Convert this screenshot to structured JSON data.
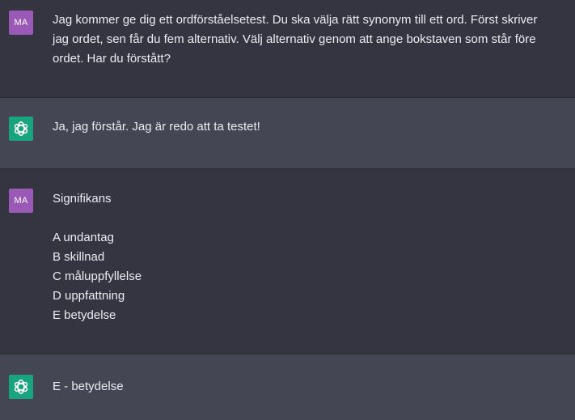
{
  "messages": [
    {
      "role": "user",
      "avatar_initials": "MA",
      "lines": [
        "Jag kommer ge dig ett ordförståelsetest. Du ska välja rätt synonym till ett ord. Först skriver",
        "jag ordet, sen får du fem alternativ. Välj alternativ genom att ange bokstaven som står före",
        "ordet. Har du förstått?"
      ]
    },
    {
      "role": "assistant",
      "avatar_icon": "openai-logo-icon",
      "lines": [
        "Ja, jag förstår. Jag är redo att ta testet!"
      ]
    },
    {
      "role": "user",
      "avatar_initials": "MA",
      "word": "Signifikans",
      "options": [
        "A undantag",
        "B skillnad",
        "C måluppfyllelse",
        "D uppfattning",
        "E betydelse"
      ]
    },
    {
      "role": "assistant",
      "avatar_icon": "openai-logo-icon",
      "lines": [
        "E - betydelse"
      ]
    }
  ],
  "colors": {
    "user_bg": "#343541",
    "assistant_bg": "#444654",
    "user_avatar": "#9b59b6",
    "assistant_avatar": "#19a37f",
    "text": "#ececf1"
  }
}
